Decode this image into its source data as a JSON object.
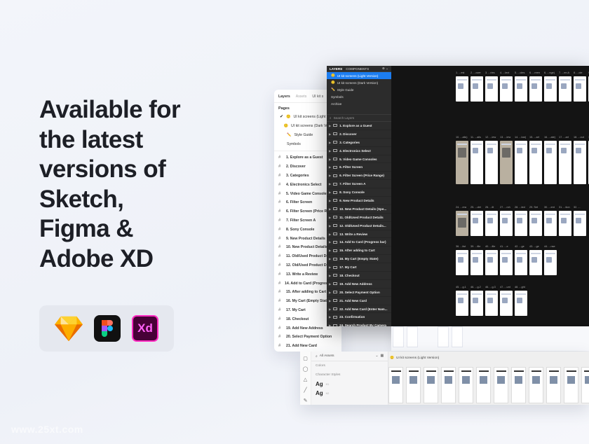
{
  "headline": [
    "Available for",
    "the latest",
    "versions of",
    "Sketch,",
    "Figma &",
    "Adobe XD"
  ],
  "badges": {
    "sketch_icon": "sketch-icon",
    "figma_icon": "figma-icon",
    "xd_label": "Xd"
  },
  "colors": {
    "accent_blue": "#1c7df0",
    "xd_bg": "#470137",
    "xd_pink": "#ff2bc2"
  },
  "sketch_panel": {
    "tabs": [
      "Layers",
      "Assets",
      "UI kit s"
    ],
    "pages_title": "Pages",
    "pages": [
      "UI kit screens (Light Version)",
      "UI kit screens (Dark Version)",
      "Style Guide",
      "Symbols"
    ],
    "layers": [
      "1. Explore as a Guest",
      "2. Discover",
      "3. Categories",
      "4. Electronics Select",
      "5. Video Game Consoles",
      "6. Filter Screen",
      "6. Filter Screen (Price Range)",
      "7. Filter Screen A",
      "8. Sony Console",
      "9. New Product Details",
      "10. New Product Details (Sp",
      "11. Old/Used Product Details",
      "12. Old/Used Product Details",
      "13. Write a Review",
      "14. Add to Card (Progress bar)",
      "15. After adding to Cart",
      "16. My Cart (Empty State)",
      "17. My Cart",
      "18. Checkout",
      "19. Add New Address",
      "20. Select Payment Option",
      "21. Add New Card"
    ]
  },
  "figma_window": {
    "tabs": [
      "LAYERS",
      "COMPONENTS"
    ],
    "tools": "⊕ ⌄",
    "pages": [
      "UI kit screens (Light Version)",
      "UI kit screens (Dark Version)",
      "Style Guide",
      "Symbols",
      "Archive"
    ],
    "search_placeholder": "Search Layers",
    "layers": [
      "1. Explore as a Guest",
      "2. Discover",
      "3. Categories",
      "4. Electronics Select",
      "5. Video Game Consoles",
      "6. Filter Screen",
      "6. Filter Screen (Price Range)",
      "7. Filter Screen A",
      "8. Sony Console",
      "9. New Product Details",
      "10. New Product Details (Spe...",
      "11. Old/Used Product Details",
      "12. Old/Used Product Details...",
      "13. Write a Review",
      "14. Add to Card (Progress bar)",
      "15. After adding to Cart",
      "16. My Cart (Empty State)",
      "17. My Cart",
      "18. Checkout",
      "19. Add New Address",
      "20. Select Payment Option",
      "21. Add New Card",
      "22. Add New Card (Enter Nam...",
      "23. Confirmation",
      "24. Search Product By Camera"
    ],
    "row1_labels": [
      "1. ...est",
      "2. ...over",
      "3. ...ries",
      "4. ...lect",
      "5. ...oles",
      "6. ...reen",
      "6. ...nge)",
      "7. ...en A",
      "8. ...ole",
      "9. ...ails"
    ],
    "row2_labels": [
      "10. ...ails)",
      "11. ...ails",
      "12. ...iew",
      "13. ...iew",
      "14. ...bar)",
      "15. ...art",
      "16. ...ate)",
      "17. ...art",
      "18. ...out",
      "19. ...ess"
    ],
    "row3_labels": [
      "24. ...era",
      "25. ...det",
      "26. ...ilt",
      "27. ...rch",
      "28. ...ted",
      "29. Set",
      "30. ...ent",
      "31. ...tion",
      "32. ..."
    ],
    "row4_labels": [
      "36. ...list",
      "39. ...file",
      "40. ...file",
      "41. ...e",
      "42. ...ge",
      "43. ...ge",
      "44. ...nse"
    ],
    "row5_labels": [
      "45. ...g.1",
      "46. ...g.2",
      "46. ...g.3",
      "47. ...unt",
      "48. ...ght"
    ]
  },
  "xd_window": {
    "search_placeholder": "All Assets",
    "colors_label": "Colors",
    "character_styles_label": "Character Styles",
    "char_samples": [
      {
        "glyph": "Ag",
        "meta": "H1"
      },
      {
        "glyph": "Ag",
        "meta": "H2"
      }
    ],
    "canvas_title": "UI kit screens (Light Version)"
  },
  "watermark": "www.25xt.com"
}
